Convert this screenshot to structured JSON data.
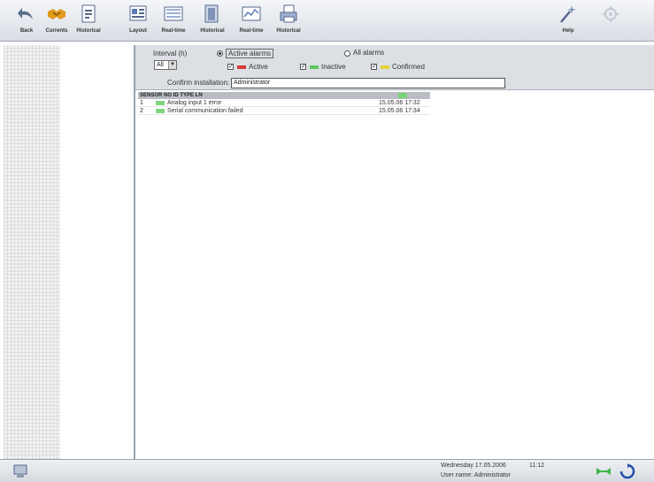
{
  "toolbar": {
    "buttons": [
      {
        "label": "Back",
        "icon": "back-arrow-icon"
      },
      {
        "label": "Currents",
        "icon": "handshake-icon"
      },
      {
        "label": "Historical",
        "icon": "document-icon"
      },
      {
        "label": "Layout",
        "icon": "layout-icon"
      },
      {
        "label": "Real-time",
        "icon": "realtime-icon"
      },
      {
        "label": "Historical",
        "icon": "report-icon"
      },
      {
        "label": "Real-time",
        "icon": "chart-icon"
      },
      {
        "label": "Historical",
        "icon": "printer-icon"
      }
    ],
    "right_buttons": [
      {
        "label": "Help",
        "icon": "magic-wand-icon"
      },
      {
        "label": "",
        "icon": "disabled-settings-icon"
      }
    ]
  },
  "filters": {
    "interval_label": "Interval (h)",
    "interval_value": "All",
    "active_alarms_label": "Active alarms",
    "all_alarms_label": "All alarms",
    "active_label": "Active",
    "inactive_label": "Inactive",
    "confirmed_label": "Confirmed",
    "confirmed_by_label": "Confirm installation:",
    "confirmed_by_value": "Administrator"
  },
  "table": {
    "header": "SENSOR NO  ID  TYPE  LN",
    "rows": [
      {
        "num": "1",
        "text": "Analog input 1 error",
        "timestamp": "15.05.06 17:32"
      },
      {
        "num": "2",
        "text": "Serial communication failed",
        "timestamp": "15.05.06 17:34"
      }
    ]
  },
  "status": {
    "date": "Wednesday  17.05.2006",
    "time": "11:12",
    "user": "User name:  Administrator"
  },
  "colors": {
    "active_red": "#d43a3a",
    "inactive_green": "#5cc85c",
    "confirmed_yellow": "#e8d23a"
  }
}
